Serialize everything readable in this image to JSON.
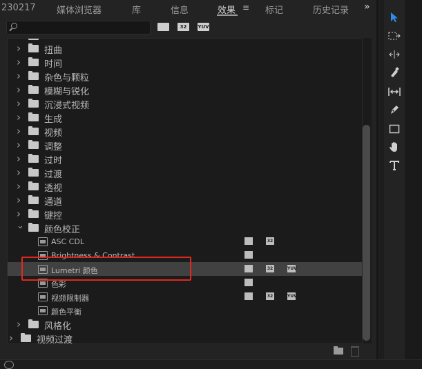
{
  "tabs": {
    "project_fragment": "230217",
    "media_browser": "媒体浏览器",
    "library": "库",
    "info": "信息",
    "effects": "效果",
    "markers": "标记",
    "history": "历史记录",
    "menu_glyph": "≡",
    "overflow_glyph": "»"
  },
  "search": {
    "value": "",
    "placeholder": ""
  },
  "filters": {
    "accelerated": "加速",
    "bit32": "32",
    "yuv": "YUV"
  },
  "tree": {
    "folders_top": [
      {
        "label": "扭曲"
      },
      {
        "label": "时间"
      },
      {
        "label": "杂色与颗粒"
      },
      {
        "label": "模糊与锐化"
      },
      {
        "label": "沉浸式视频"
      },
      {
        "label": "生成"
      },
      {
        "label": "视频"
      },
      {
        "label": "调整"
      },
      {
        "label": "过时"
      },
      {
        "label": "过渡"
      },
      {
        "label": "透视"
      },
      {
        "label": "通道"
      },
      {
        "label": "键控"
      }
    ],
    "color_correction": {
      "label": "颜色校正",
      "items": [
        {
          "label": "ASC CDL"
        },
        {
          "label": "Brightness & Contrast"
        },
        {
          "label": "Lumetri 颜色"
        },
        {
          "label": "色彩"
        },
        {
          "label": "视频限制器"
        },
        {
          "label": "颜色平衡"
        }
      ]
    },
    "stylize": {
      "label": "风格化"
    },
    "video_transitions": {
      "label": "视频过渡"
    }
  },
  "tools": {
    "selection": "selection-tool-icon",
    "track_select": "track-select-icon",
    "ripple": "ripple-edit-icon",
    "razor": "razor-icon",
    "slip": "slip-icon",
    "pen": "pen-icon",
    "rectangle": "rectangle-icon",
    "hand": "hand-icon",
    "type": "type-icon"
  },
  "colors": {
    "accent": "#2d8ceb",
    "highlight": "#e0281e"
  }
}
